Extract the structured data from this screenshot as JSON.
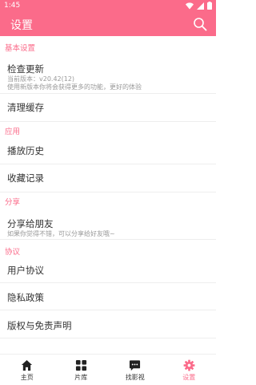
{
  "statusbar": {
    "time": "1:45"
  },
  "appbar": {
    "title": "设置"
  },
  "sections": [
    {
      "title": "基本设置",
      "items": [
        {
          "label": "检查更新",
          "sub": "当前版本：v20.42(12)",
          "sub2": "使用新版本你将会获得更多的功能，更好的体验"
        },
        {
          "label": "清理缓存"
        }
      ]
    },
    {
      "title": "应用",
      "items": [
        {
          "label": "播放历史"
        },
        {
          "label": "收藏记录"
        }
      ]
    },
    {
      "title": "分享",
      "items": [
        {
          "label": "分享给朋友",
          "sub": "如果你觉得不错，可以分享给好友哦~"
        }
      ]
    },
    {
      "title": "协议",
      "items": [
        {
          "label": "用户协议"
        },
        {
          "label": "隐私政策"
        },
        {
          "label": "版权与免责声明"
        }
      ]
    }
  ],
  "tabs": [
    {
      "label": "主页",
      "icon": "home-icon"
    },
    {
      "label": "片库",
      "icon": "grid-icon"
    },
    {
      "label": "找影视",
      "icon": "chat-icon"
    },
    {
      "label": "设置",
      "icon": "settings-icon",
      "active": true
    }
  ],
  "colors": {
    "accent": "#fb6b8a"
  }
}
